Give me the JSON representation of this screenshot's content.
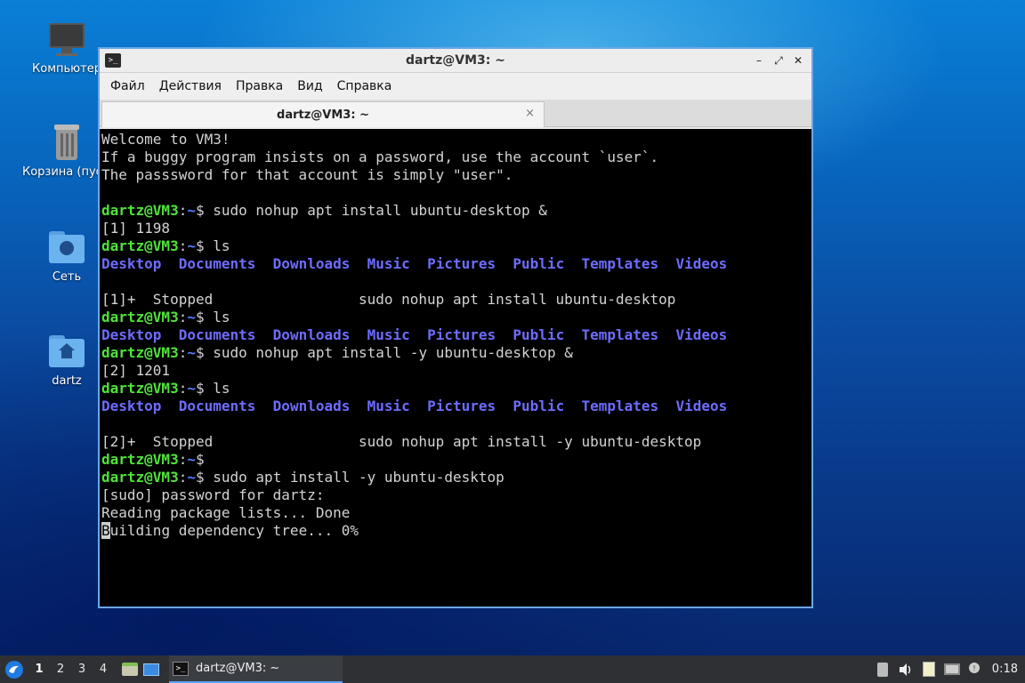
{
  "desktop": {
    "icons": [
      {
        "label": "Компьютер"
      },
      {
        "label": "Корзина (пустая)"
      },
      {
        "label": "Сеть"
      },
      {
        "label": "dartz"
      }
    ]
  },
  "window": {
    "title": "dartz@VM3: ~",
    "menu": [
      "Файл",
      "Действия",
      "Правка",
      "Вид",
      "Справка"
    ],
    "tab_title": "dartz@VM3: ~",
    "close_glyph": "×"
  },
  "terminal": {
    "prompt_user": "dartz@VM3",
    "prompt_colon": ":",
    "prompt_path": "~",
    "prompt_dollar": "$",
    "welcome": [
      "Welcome to VM3!",
      "If a buggy program insists on a password, use the account `user`.",
      "The passsword for that account is simply \"user\"."
    ],
    "dirs": [
      "Desktop",
      "Documents",
      "Downloads",
      "Music",
      "Pictures",
      "Public",
      "Templates",
      "Videos"
    ],
    "cmd1": " sudo nohup apt install ubuntu-desktop &",
    "job1": "[1] 1198",
    "cmd_ls": " ls",
    "stopped1": "[1]+  Stopped                 sudo nohup apt install ubuntu-desktop",
    "cmd2": " sudo nohup apt install -y ubuntu-desktop &",
    "job2": "[2] 1201",
    "stopped2": "[2]+  Stopped                 sudo nohup apt install -y ubuntu-desktop",
    "cmd3": " sudo apt install -y ubuntu-desktop",
    "sudo_prompt": "[sudo] password for dartz:",
    "reading": "Reading package lists... Done",
    "building_cursor": "B",
    "building_rest": "uilding dependency tree... 0%"
  },
  "taskbar": {
    "workspaces": [
      "1",
      "2",
      "3",
      "4"
    ],
    "task_label": "dartz@VM3: ~",
    "clock": "0:18"
  },
  "colors": {
    "prompt_user": "#4fe33a",
    "prompt_path": "#5a7bff",
    "dir": "#6e6cff",
    "window_border": "#6aa7e6"
  }
}
